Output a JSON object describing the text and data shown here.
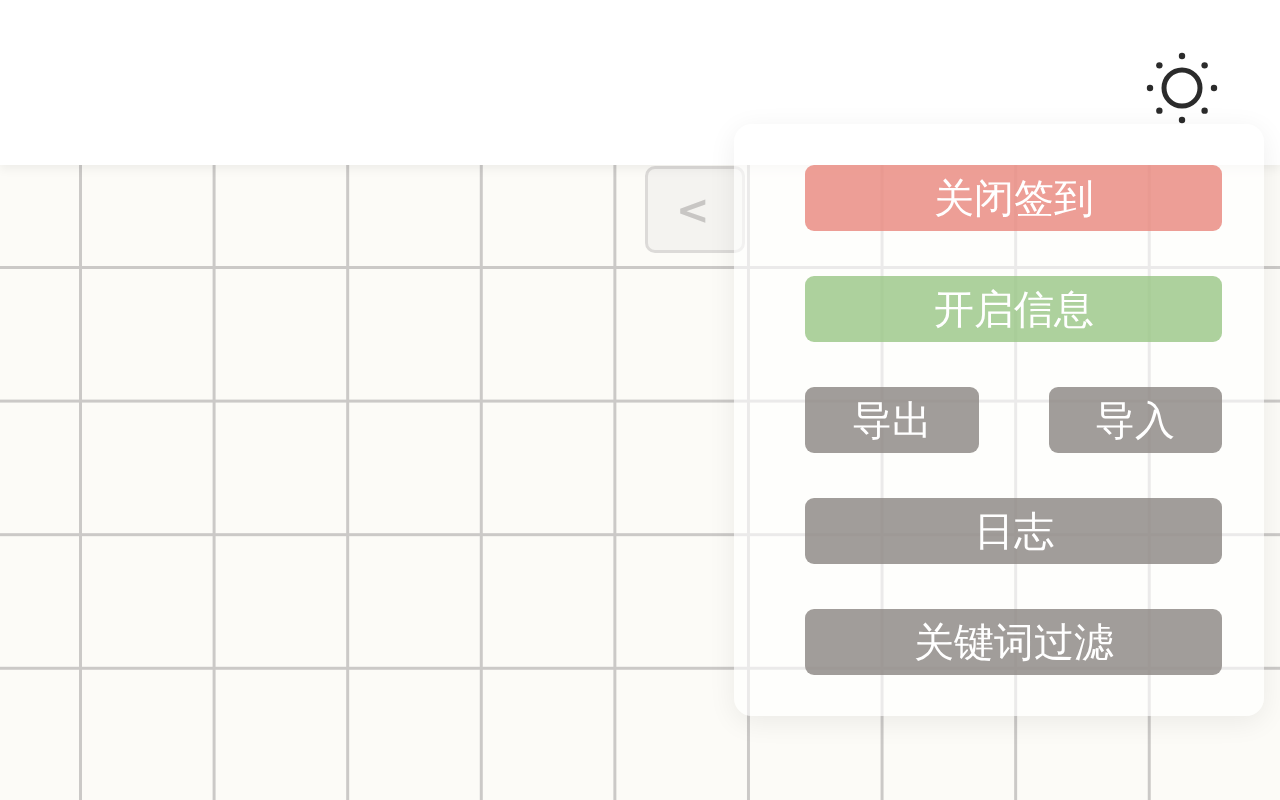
{
  "header": {
    "theme_toggle": {
      "kind": "sun"
    }
  },
  "collapse_button": {
    "label": "<"
  },
  "panel": {
    "rows": [
      [
        {
          "label": "关闭签到",
          "kind": "danger"
        }
      ],
      [
        {
          "label": "开启信息",
          "kind": "success"
        }
      ],
      [
        {
          "label": "导出",
          "kind": "neutral"
        },
        {
          "label": "导入",
          "kind": "neutral"
        }
      ],
      [
        {
          "label": "日志",
          "kind": "neutral"
        }
      ],
      [
        {
          "label": "关键词过滤",
          "kind": "neutral"
        }
      ]
    ]
  }
}
